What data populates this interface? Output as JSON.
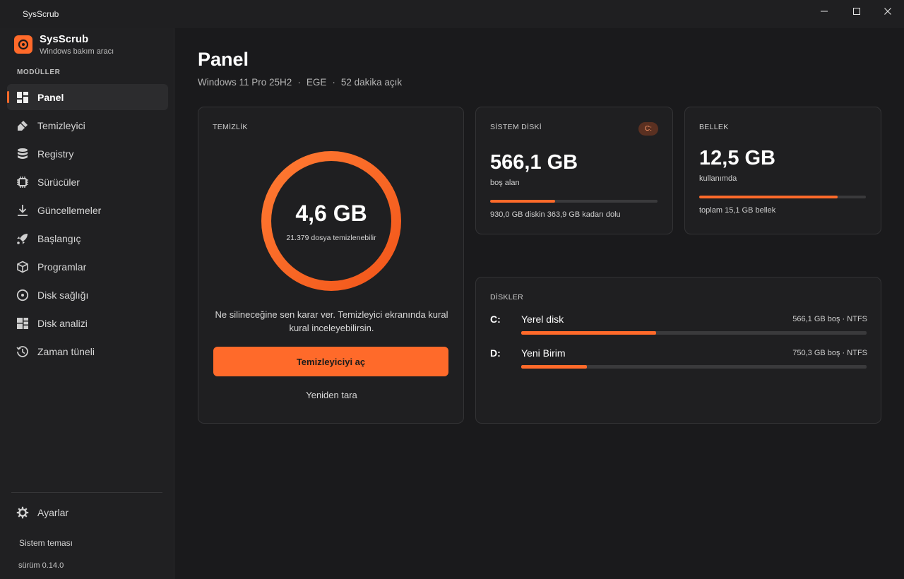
{
  "window": {
    "title": "SysScrub"
  },
  "brand": {
    "name": "SysScrub",
    "subtitle": "Windows bakım aracı"
  },
  "sidebar": {
    "section_label": "MODÜLLER",
    "items": [
      {
        "label": "Panel",
        "icon": "dashboard-icon",
        "active": true
      },
      {
        "label": "Temizleyici",
        "icon": "broom-icon",
        "active": false
      },
      {
        "label": "Registry",
        "icon": "database-icon",
        "active": false
      },
      {
        "label": "Sürücüler",
        "icon": "chip-icon",
        "active": false
      },
      {
        "label": "Güncellemeler",
        "icon": "download-icon",
        "active": false
      },
      {
        "label": "Başlangıç",
        "icon": "rocket-icon",
        "active": false
      },
      {
        "label": "Programlar",
        "icon": "package-icon",
        "active": false
      },
      {
        "label": "Disk sağlığı",
        "icon": "disk-health-icon",
        "active": false
      },
      {
        "label": "Disk analizi",
        "icon": "treemap-icon",
        "active": false
      },
      {
        "label": "Zaman tüneli",
        "icon": "history-icon",
        "active": false
      }
    ],
    "settings_label": "Ayarlar",
    "theme_label": "Sistem teması",
    "version_label": "sürüm 0.14.0"
  },
  "main": {
    "title": "Panel",
    "sysinfo": {
      "os": "Windows 11 Pro 25H2",
      "host": "EGE",
      "uptime": "52 dakika açık"
    }
  },
  "clean_card": {
    "label": "TEMİZLİK",
    "value": "4,6 GB",
    "sub": "21.379 dosya temizlenebilir",
    "description": "Ne silineceğine sen karar ver. Temizleyici ekranında kural kural inceleyebilirsin.",
    "primary_button": "Temizleyiciyi aç",
    "secondary_button": "Yeniden tara"
  },
  "system_disk": {
    "label": "SİSTEM DİSKİ",
    "badge": "C:",
    "value": "566,1 GB",
    "sub": "boş alan",
    "used_fraction": 0.39,
    "footer": "930,0 GB diskin 363,9 GB kadarı dolu"
  },
  "memory": {
    "label": "BELLEK",
    "value": "12,5 GB",
    "sub": "kullanımda",
    "used_fraction": 0.83,
    "footer": "toplam 15,1 GB bellek"
  },
  "disks": {
    "label": "DİSKLER",
    "items": [
      {
        "letter": "C:",
        "name": "Yerel disk",
        "info": "566,1 GB boş · NTFS",
        "used_fraction": 0.39
      },
      {
        "letter": "D:",
        "name": "Yeni Birim",
        "info": "750,3 GB boş · NTFS",
        "used_fraction": 0.19
      }
    ]
  },
  "colors": {
    "accent": "#ff6a2a",
    "background": "#1a1a1c",
    "sidebar": "#202022",
    "card": "#1f1f21",
    "track": "#3a3a3c"
  }
}
